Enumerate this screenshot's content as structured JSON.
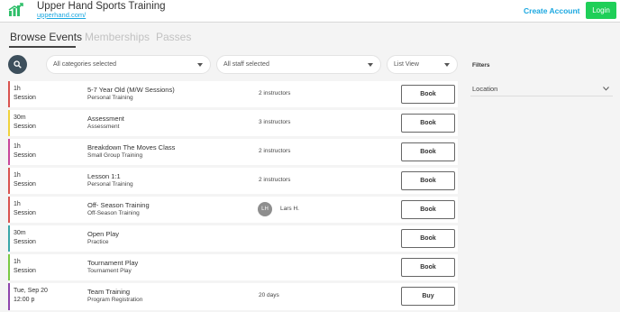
{
  "header": {
    "brand_name": "Upper Hand Sports Training",
    "brand_url": "upperhand.com/",
    "create_account_label": "Create Account",
    "login_label": "Login"
  },
  "tabs": [
    {
      "label": "Browse Events",
      "active": true
    },
    {
      "label": "Memberships",
      "active": false
    },
    {
      "label": "Passes",
      "active": false
    }
  ],
  "filters_bar": {
    "category_select": "All categories selected",
    "staff_select": "All staff selected",
    "view_select": "List View"
  },
  "sidebar": {
    "filters_label": "Filters",
    "location_label": "Location"
  },
  "events": [
    {
      "duration": "1h",
      "kind": "Session",
      "title": "5-7 Year Old (M/W Sessions)",
      "subtitle": "Personal Training",
      "info": "2 instructors",
      "staff_initials": "",
      "staff_name": "",
      "action": "Book",
      "color": "#d9534f"
    },
    {
      "duration": "30m",
      "kind": "Session",
      "title": "Assessment",
      "subtitle": "Assessment",
      "info": "3 instructors",
      "staff_initials": "",
      "staff_name": "",
      "action": "Book",
      "color": "#f0d23c"
    },
    {
      "duration": "1h",
      "kind": "Session",
      "title": "Breakdown The Moves Class",
      "subtitle": "Small Group Training",
      "info": "2 instructors",
      "staff_initials": "",
      "staff_name": "",
      "action": "Book",
      "color": "#c8469b"
    },
    {
      "duration": "1h",
      "kind": "Session",
      "title": "Lesson 1:1",
      "subtitle": "Personal Training",
      "info": "2 instructors",
      "staff_initials": "",
      "staff_name": "",
      "action": "Book",
      "color": "#d9534f"
    },
    {
      "duration": "1h",
      "kind": "Session",
      "title": "Off- Season Training",
      "subtitle": "Off-Season Training",
      "info": "",
      "staff_initials": "LH",
      "staff_name": "Lars H.",
      "action": "Book",
      "color": "#d9534f"
    },
    {
      "duration": "30m",
      "kind": "Session",
      "title": "Open Play",
      "subtitle": "Practice",
      "info": "",
      "staff_initials": "",
      "staff_name": "",
      "action": "Book",
      "color": "#3aa6a8"
    },
    {
      "duration": "1h",
      "kind": "Session",
      "title": "Tournament Play",
      "subtitle": "Tournament Play",
      "info": "",
      "staff_initials": "",
      "staff_name": "",
      "action": "Book",
      "color": "#7ac943"
    },
    {
      "duration": "Tue, Sep 20",
      "kind": "12:00 p",
      "title": "Team Training",
      "subtitle": "Program Registration",
      "info": "20 days",
      "staff_initials": "",
      "staff_name": "",
      "action": "Buy",
      "color": "#8e44ad"
    }
  ],
  "colors": {
    "accent": "#1aa7e0",
    "login_green": "#1fcf58",
    "search_button": "#3d4f5c"
  }
}
